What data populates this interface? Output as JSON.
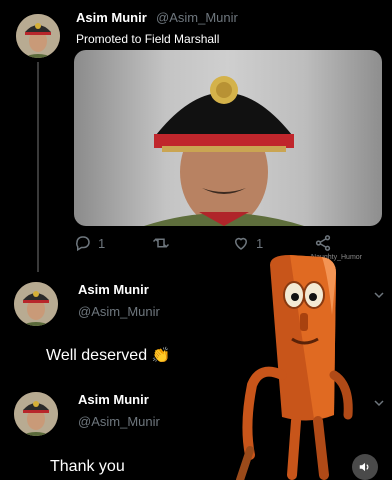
{
  "tweet": {
    "author_name": "Asim Munir",
    "author_handle": "@Asim_Munir",
    "text": "Promoted to Field Marshall",
    "reply_count": "1",
    "like_count": "1",
    "watermark": "Naughty_Humor"
  },
  "replies": [
    {
      "author_name": "Asim Munir",
      "author_handle": "@Asim_Munir",
      "text": "Well deserved",
      "emoji": "👏"
    },
    {
      "author_name": "Asim Munir",
      "author_handle": "@Asim_Munir",
      "text": "Thank you"
    }
  ],
  "icons": {
    "reply": "reply-icon",
    "retweet": "retweet-icon",
    "like": "heart-icon",
    "share": "share-icon",
    "sound": "speaker-icon",
    "collapse": "chevron-down-icon"
  },
  "colors": {
    "background": "#000000",
    "muted": "#6e767d",
    "text": "#ffffff"
  }
}
